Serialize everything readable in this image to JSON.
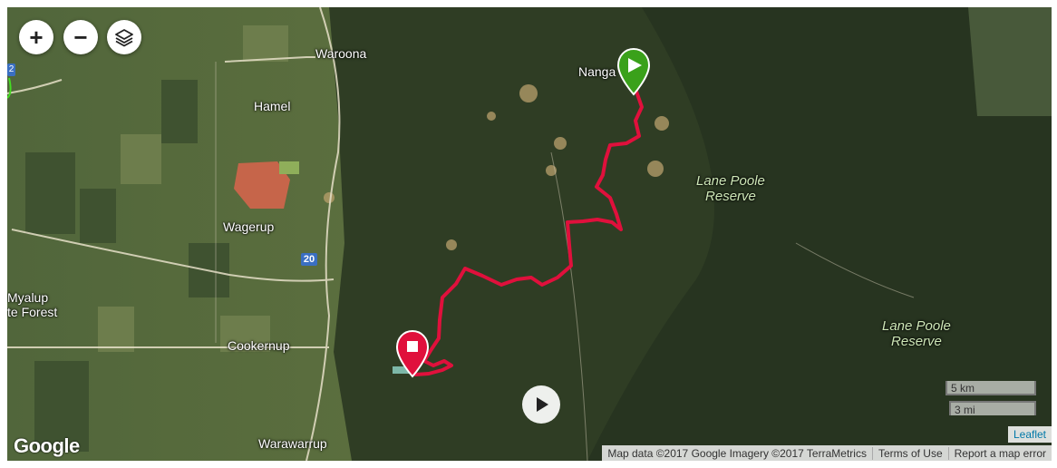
{
  "places": [
    {
      "label": "Waroona"
    },
    {
      "label": "Hamel"
    },
    {
      "label": "Wagerup"
    },
    {
      "label": "Cookernup"
    },
    {
      "label": "Warawarrup"
    },
    {
      "label": "Nanga"
    },
    {
      "label": "Myalup"
    },
    {
      "label": "te Forest"
    }
  ],
  "reserves": [
    {
      "line1": "Lane Poole",
      "line2": "Reserve"
    },
    {
      "line1": "Lane Poole",
      "line2": "Reserve"
    }
  ],
  "road_shield": "20",
  "road_shield_left": "2",
  "controls": {
    "zoom_in": "+",
    "zoom_out": "−"
  },
  "scale": {
    "km": "5 km",
    "mi": "3 mi"
  },
  "leaflet": "Leaflet",
  "google": "Google",
  "attribution": {
    "data": "Map data ©2017 Google Imagery ©2017 TerraMetrics",
    "terms": "Terms of Use",
    "report": "Report a map error"
  },
  "colors": {
    "track": "#e0103c",
    "start_marker": "#3aa11a",
    "end_marker": "#e0103c"
  }
}
